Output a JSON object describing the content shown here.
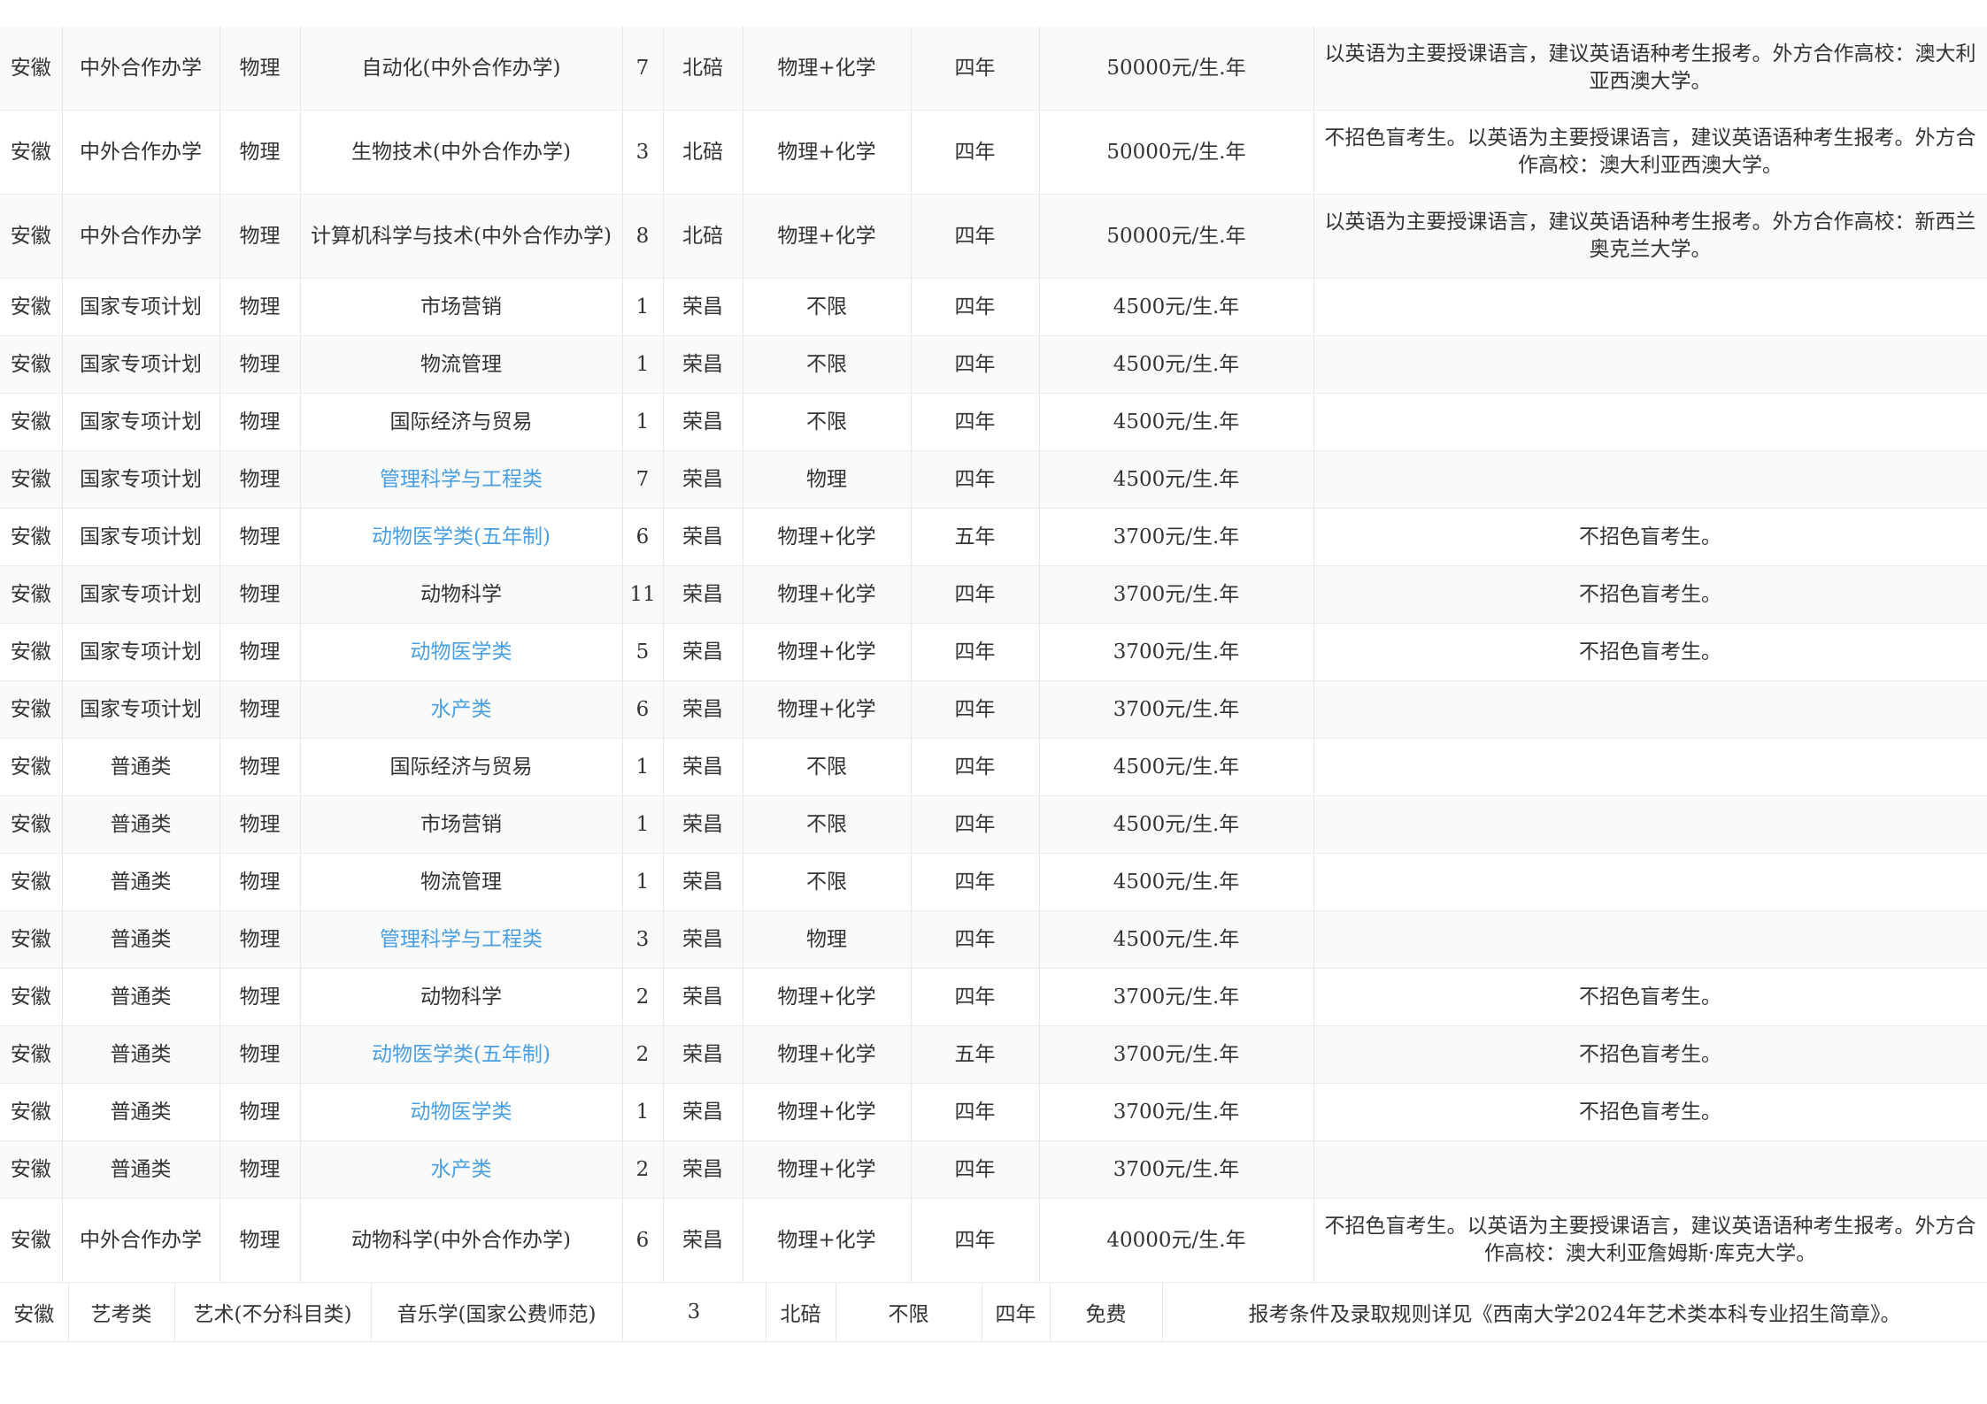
{
  "rows": [
    {
      "province": "安徽",
      "category": "中外合作办学",
      "subject": "物理",
      "major": "自动化(中外合作办学)",
      "major_link": false,
      "count": "7",
      "campus": "北碚",
      "requirement": "物理+化学",
      "duration": "四年",
      "fee": "50000元/生.年",
      "note": "以英语为主要授课语言，建议英语语种考生报考。外方合作高校：澳大利亚西澳大学。"
    },
    {
      "province": "安徽",
      "category": "中外合作办学",
      "subject": "物理",
      "major": "生物技术(中外合作办学)",
      "major_link": false,
      "count": "3",
      "campus": "北碚",
      "requirement": "物理+化学",
      "duration": "四年",
      "fee": "50000元/生.年",
      "note": "不招色盲考生。以英语为主要授课语言，建议英语语种考生报考。外方合作高校：澳大利亚西澳大学。"
    },
    {
      "province": "安徽",
      "category": "中外合作办学",
      "subject": "物理",
      "major": "计算机科学与技术(中外合作办学)",
      "major_link": false,
      "count": "8",
      "campus": "北碚",
      "requirement": "物理+化学",
      "duration": "四年",
      "fee": "50000元/生.年",
      "note": "以英语为主要授课语言，建议英语语种考生报考。外方合作高校：新西兰奥克兰大学。"
    },
    {
      "province": "安徽",
      "category": "国家专项计划",
      "subject": "物理",
      "major": "市场营销",
      "major_link": false,
      "count": "1",
      "campus": "荣昌",
      "requirement": "不限",
      "duration": "四年",
      "fee": "4500元/生.年",
      "note": ""
    },
    {
      "province": "安徽",
      "category": "国家专项计划",
      "subject": "物理",
      "major": "物流管理",
      "major_link": false,
      "count": "1",
      "campus": "荣昌",
      "requirement": "不限",
      "duration": "四年",
      "fee": "4500元/生.年",
      "note": ""
    },
    {
      "province": "安徽",
      "category": "国家专项计划",
      "subject": "物理",
      "major": "国际经济与贸易",
      "major_link": false,
      "count": "1",
      "campus": "荣昌",
      "requirement": "不限",
      "duration": "四年",
      "fee": "4500元/生.年",
      "note": ""
    },
    {
      "province": "安徽",
      "category": "国家专项计划",
      "subject": "物理",
      "major": "管理科学与工程类",
      "major_link": true,
      "count": "7",
      "campus": "荣昌",
      "requirement": "物理",
      "duration": "四年",
      "fee": "4500元/生.年",
      "note": ""
    },
    {
      "province": "安徽",
      "category": "国家专项计划",
      "subject": "物理",
      "major": "动物医学类(五年制)",
      "major_link": true,
      "count": "6",
      "campus": "荣昌",
      "requirement": "物理+化学",
      "duration": "五年",
      "fee": "3700元/生.年",
      "note": "不招色盲考生。"
    },
    {
      "province": "安徽",
      "category": "国家专项计划",
      "subject": "物理",
      "major": "动物科学",
      "major_link": false,
      "count": "11",
      "campus": "荣昌",
      "requirement": "物理+化学",
      "duration": "四年",
      "fee": "3700元/生.年",
      "note": "不招色盲考生。"
    },
    {
      "province": "安徽",
      "category": "国家专项计划",
      "subject": "物理",
      "major": "动物医学类",
      "major_link": true,
      "count": "5",
      "campus": "荣昌",
      "requirement": "物理+化学",
      "duration": "四年",
      "fee": "3700元/生.年",
      "note": "不招色盲考生。"
    },
    {
      "province": "安徽",
      "category": "国家专项计划",
      "subject": "物理",
      "major": "水产类",
      "major_link": true,
      "count": "6",
      "campus": "荣昌",
      "requirement": "物理+化学",
      "duration": "四年",
      "fee": "3700元/生.年",
      "note": ""
    },
    {
      "province": "安徽",
      "category": "普通类",
      "subject": "物理",
      "major": "国际经济与贸易",
      "major_link": false,
      "count": "1",
      "campus": "荣昌",
      "requirement": "不限",
      "duration": "四年",
      "fee": "4500元/生.年",
      "note": ""
    },
    {
      "province": "安徽",
      "category": "普通类",
      "subject": "物理",
      "major": "市场营销",
      "major_link": false,
      "count": "1",
      "campus": "荣昌",
      "requirement": "不限",
      "duration": "四年",
      "fee": "4500元/生.年",
      "note": ""
    },
    {
      "province": "安徽",
      "category": "普通类",
      "subject": "物理",
      "major": "物流管理",
      "major_link": false,
      "count": "1",
      "campus": "荣昌",
      "requirement": "不限",
      "duration": "四年",
      "fee": "4500元/生.年",
      "note": ""
    },
    {
      "province": "安徽",
      "category": "普通类",
      "subject": "物理",
      "major": "管理科学与工程类",
      "major_link": true,
      "count": "3",
      "campus": "荣昌",
      "requirement": "物理",
      "duration": "四年",
      "fee": "4500元/生.年",
      "note": ""
    },
    {
      "province": "安徽",
      "category": "普通类",
      "subject": "物理",
      "major": "动物科学",
      "major_link": false,
      "count": "2",
      "campus": "荣昌",
      "requirement": "物理+化学",
      "duration": "四年",
      "fee": "3700元/生.年",
      "note": "不招色盲考生。"
    },
    {
      "province": "安徽",
      "category": "普通类",
      "subject": "物理",
      "major": "动物医学类(五年制)",
      "major_link": true,
      "count": "2",
      "campus": "荣昌",
      "requirement": "物理+化学",
      "duration": "五年",
      "fee": "3700元/生.年",
      "note": "不招色盲考生。"
    },
    {
      "province": "安徽",
      "category": "普通类",
      "subject": "物理",
      "major": "动物医学类",
      "major_link": true,
      "count": "1",
      "campus": "荣昌",
      "requirement": "物理+化学",
      "duration": "四年",
      "fee": "3700元/生.年",
      "note": "不招色盲考生。"
    },
    {
      "province": "安徽",
      "category": "普通类",
      "subject": "物理",
      "major": "水产类",
      "major_link": true,
      "count": "2",
      "campus": "荣昌",
      "requirement": "物理+化学",
      "duration": "四年",
      "fee": "3700元/生.年",
      "note": ""
    },
    {
      "province": "安徽",
      "category": "中外合作办学",
      "subject": "物理",
      "major": "动物科学(中外合作办学)",
      "major_link": false,
      "count": "6",
      "campus": "荣昌",
      "requirement": "物理+化学",
      "duration": "四年",
      "fee": "40000元/生.年",
      "note": "不招色盲考生。以英语为主要授课语言，建议英语语种考生报考。外方合作高校：澳大利亚詹姆斯·库克大学。"
    }
  ],
  "art_row": {
    "province": "安徽",
    "category": "艺考类",
    "subject": "艺术(不分科目类)",
    "major": "音乐学(国家公费师范)",
    "count": "3",
    "campus": "北碚",
    "requirement": "不限",
    "duration": "四年",
    "fee": "免费",
    "note": "报考条件及录取规则详见《西南大学2024年艺术类本科专业招生简章》。"
  },
  "colors": {
    "link": "#4a9fe3",
    "text": "#333333",
    "border": "#e6e6e6"
  }
}
